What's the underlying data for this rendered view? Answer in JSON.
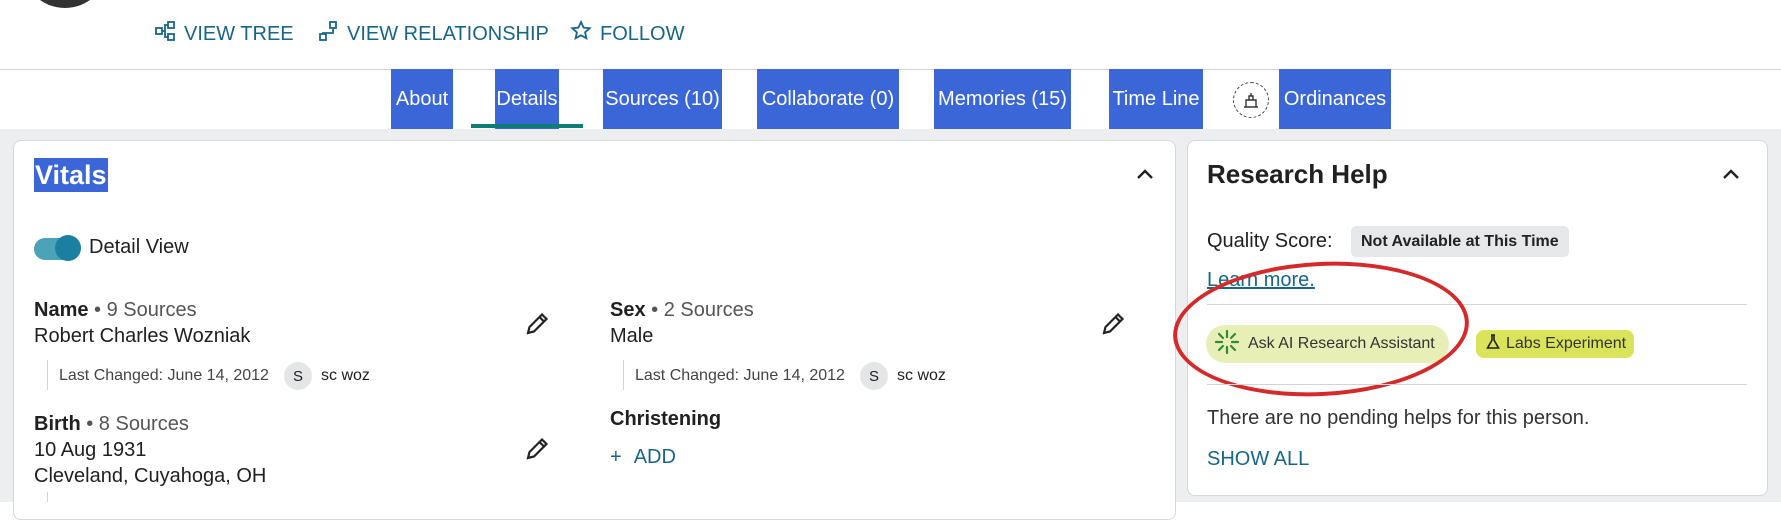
{
  "header": {
    "actions": [
      {
        "label": "VIEW TREE",
        "icon": "tree-icon"
      },
      {
        "label": "VIEW RELATIONSHIP",
        "icon": "relationship-icon"
      },
      {
        "label": "FOLLOW",
        "icon": "star-icon"
      }
    ]
  },
  "tabs": [
    {
      "label": "About",
      "active": false
    },
    {
      "label": "Details",
      "active": true
    },
    {
      "label": "Sources (10)",
      "active": false
    },
    {
      "label": "Collaborate (0)",
      "active": false
    },
    {
      "label": "Memories (15)",
      "active": false
    },
    {
      "label": "Time Line",
      "active": false
    },
    {
      "label": "Ordinances",
      "active": false,
      "icon": "temple-icon"
    }
  ],
  "vitals": {
    "title": "Vitals",
    "detail_view_label": "Detail View",
    "detail_view_on": true,
    "name": {
      "label": "Name",
      "sources": "• 9 Sources",
      "value": "Robert Charles Wozniak",
      "last_changed": "Last Changed: June 14, 2012",
      "contributor_initial": "S",
      "contributor": "sc woz"
    },
    "sex": {
      "label": "Sex",
      "sources": "• 2 Sources",
      "value": "Male",
      "last_changed": "Last Changed: June 14, 2012",
      "contributor_initial": "S",
      "contributor": "sc woz"
    },
    "birth": {
      "label": "Birth",
      "sources": "• 8 Sources",
      "date": "10 Aug 1931",
      "place": "Cleveland, Cuyahoga, OH"
    },
    "christening": {
      "label": "Christening",
      "add_label": "ADD",
      "add_icon": "+"
    }
  },
  "research_help": {
    "title": "Research Help",
    "quality_label": "Quality Score:",
    "quality_value": "Not Available at This Time",
    "learn_more": "Learn more.",
    "ai_button": "Ask AI Research Assistant",
    "labs_badge": "Labs Experiment",
    "no_helps": "There are no pending helps for this person.",
    "show_all": "SHOW ALL"
  },
  "colors": {
    "tab_highlight": "#3a66d8",
    "link": "#176588",
    "active_underline": "#0d7d78",
    "ai_button_bg": "#e8efb6",
    "labs_badge_bg": "#d9e45a",
    "annotation_circle": "#d42a2a"
  }
}
